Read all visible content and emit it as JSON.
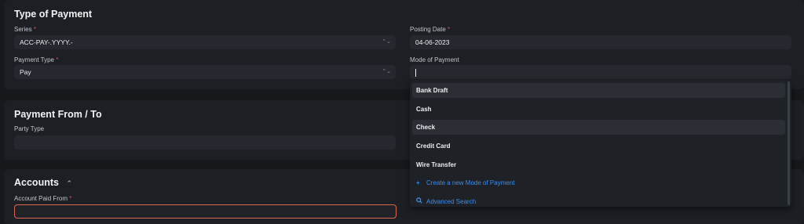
{
  "type_of_payment": {
    "title": "Type of Payment",
    "series": {
      "label": "Series",
      "required": "*",
      "value": "ACC-PAY-.YYYY.-"
    },
    "posting_date": {
      "label": "Posting Date",
      "required": "*",
      "value": "04-06-2023"
    },
    "payment_type": {
      "label": "Payment Type",
      "required": "*",
      "value": "Pay"
    },
    "mode_of_payment": {
      "label": "Mode of Payment",
      "value": ""
    }
  },
  "dropdown": {
    "options": [
      "Bank Draft",
      "Cash",
      "Check",
      "Credit Card",
      "Wire Transfer"
    ],
    "create_label": "Create a new Mode of Payment",
    "advanced_search_label": "Advanced Search"
  },
  "payment_from_to": {
    "title": "Payment From / To",
    "party_type": {
      "label": "Party Type",
      "value": ""
    }
  },
  "accounts": {
    "title": "Accounts",
    "account_paid_from": {
      "label": "Account Paid From",
      "required": "*",
      "value": ""
    }
  },
  "icons": {
    "select_arrow": "updown-chevron-icon",
    "collapse": "chevron-up-icon",
    "create": "plus-icon",
    "search": "search-icon"
  },
  "colors": {
    "required": "#e24c4c",
    "link": "#3b8ef0",
    "error_border": "#e0664f"
  }
}
